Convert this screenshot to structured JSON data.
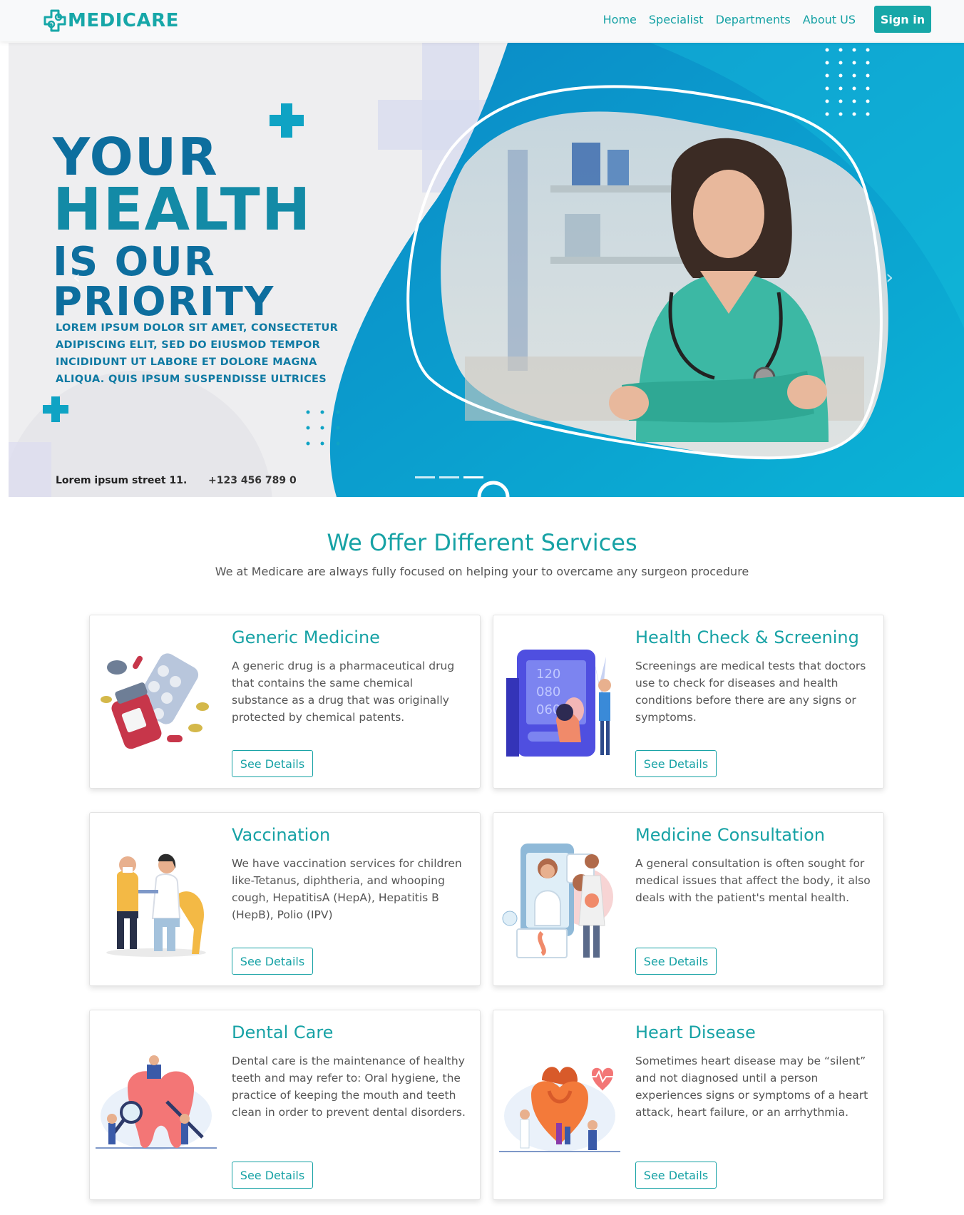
{
  "nav": {
    "brand": "MEDICARE",
    "links": [
      "Home",
      "Specialist",
      "Departments",
      "About US"
    ],
    "signin": "Sign in"
  },
  "hero": {
    "title_line1": "YOUR",
    "title_line2": "HEALTH",
    "title_line3": "IS OUR",
    "title_line4": "PRIORITY",
    "subtitle": "LOREM IPSUM DOLOR SIT AMET, CONSECTETUR ADIPISCING ELIT, SED DO EIUSMOD TEMPOR INCIDIDUNT UT LABORE ET DOLORE MAGNA ALIQUA. QUIS IPSUM SUSPENDISSE ULTRICES",
    "address": "Lorem ipsum street 11.",
    "phone": "+123 456 789 0",
    "prev_glyph": "‹",
    "next_glyph": "›"
  },
  "services": {
    "title": "We Offer Different Services",
    "subtitle": "We at Medicare are always fully focused on helping your to overcame any surgeon procedure",
    "button_label": "See Details",
    "cards": [
      {
        "title": "Generic Medicine",
        "description": "A generic drug is a pharmaceutical drug that contains the same chemical substance as a drug that was originally protected by chemical patents.",
        "icon": "medicine-pills-icon"
      },
      {
        "title": "Health Check & Screening",
        "description": "Screenings are medical tests that doctors use to check for diseases and health conditions before there are any signs or symptoms.",
        "icon": "blood-pressure-monitor-icon"
      },
      {
        "title": "Vaccination",
        "description": "We have vaccination services for children like-Tetanus, diphtheria, and whooping cough, HepatitisA (HepA), Hepatitis B (HepB), Polio (IPV)",
        "icon": "vaccination-icon"
      },
      {
        "title": "Medicine Consultation",
        "description": "A general consultation is often sought for medical issues that affect the body, it also deals with the patient's mental health.",
        "icon": "online-consultation-icon"
      },
      {
        "title": "Dental Care",
        "description": "Dental care is the maintenance of healthy teeth and may refer to: Oral hygiene, the practice of keeping the mouth and teeth clean in order to prevent dental disorders.",
        "icon": "tooth-care-icon"
      },
      {
        "title": "Heart Disease",
        "description": "Sometimes heart disease may be “silent” and not diagnosed until a person experiences signs or symptoms of a heart attack, heart failure, or an arrhythmia.",
        "icon": "heart-anatomy-icon"
      }
    ]
  },
  "colors": {
    "brand": "#17a7a8",
    "hero_blue": "#0d6e9e",
    "hero_teal": "#0fa3c4"
  }
}
